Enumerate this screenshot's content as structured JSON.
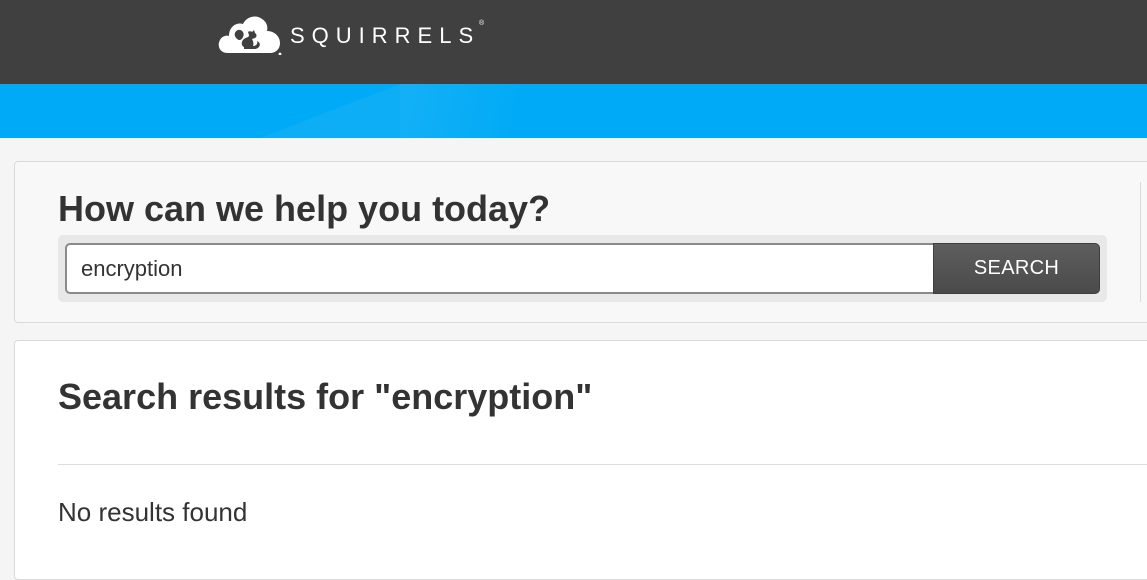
{
  "header": {
    "brand": "SQUIRRELS",
    "trademark": "®",
    "logo_icon": "cloud-squirrel-icon",
    "colors": {
      "topbar": "#404040",
      "banner": "#00aaf6"
    }
  },
  "help": {
    "title": "How can we help you today?",
    "search": {
      "value": "encryption",
      "button_label": "SEARCH"
    }
  },
  "results": {
    "title": "Search results for \"encryption\"",
    "empty_message": "No results found"
  }
}
